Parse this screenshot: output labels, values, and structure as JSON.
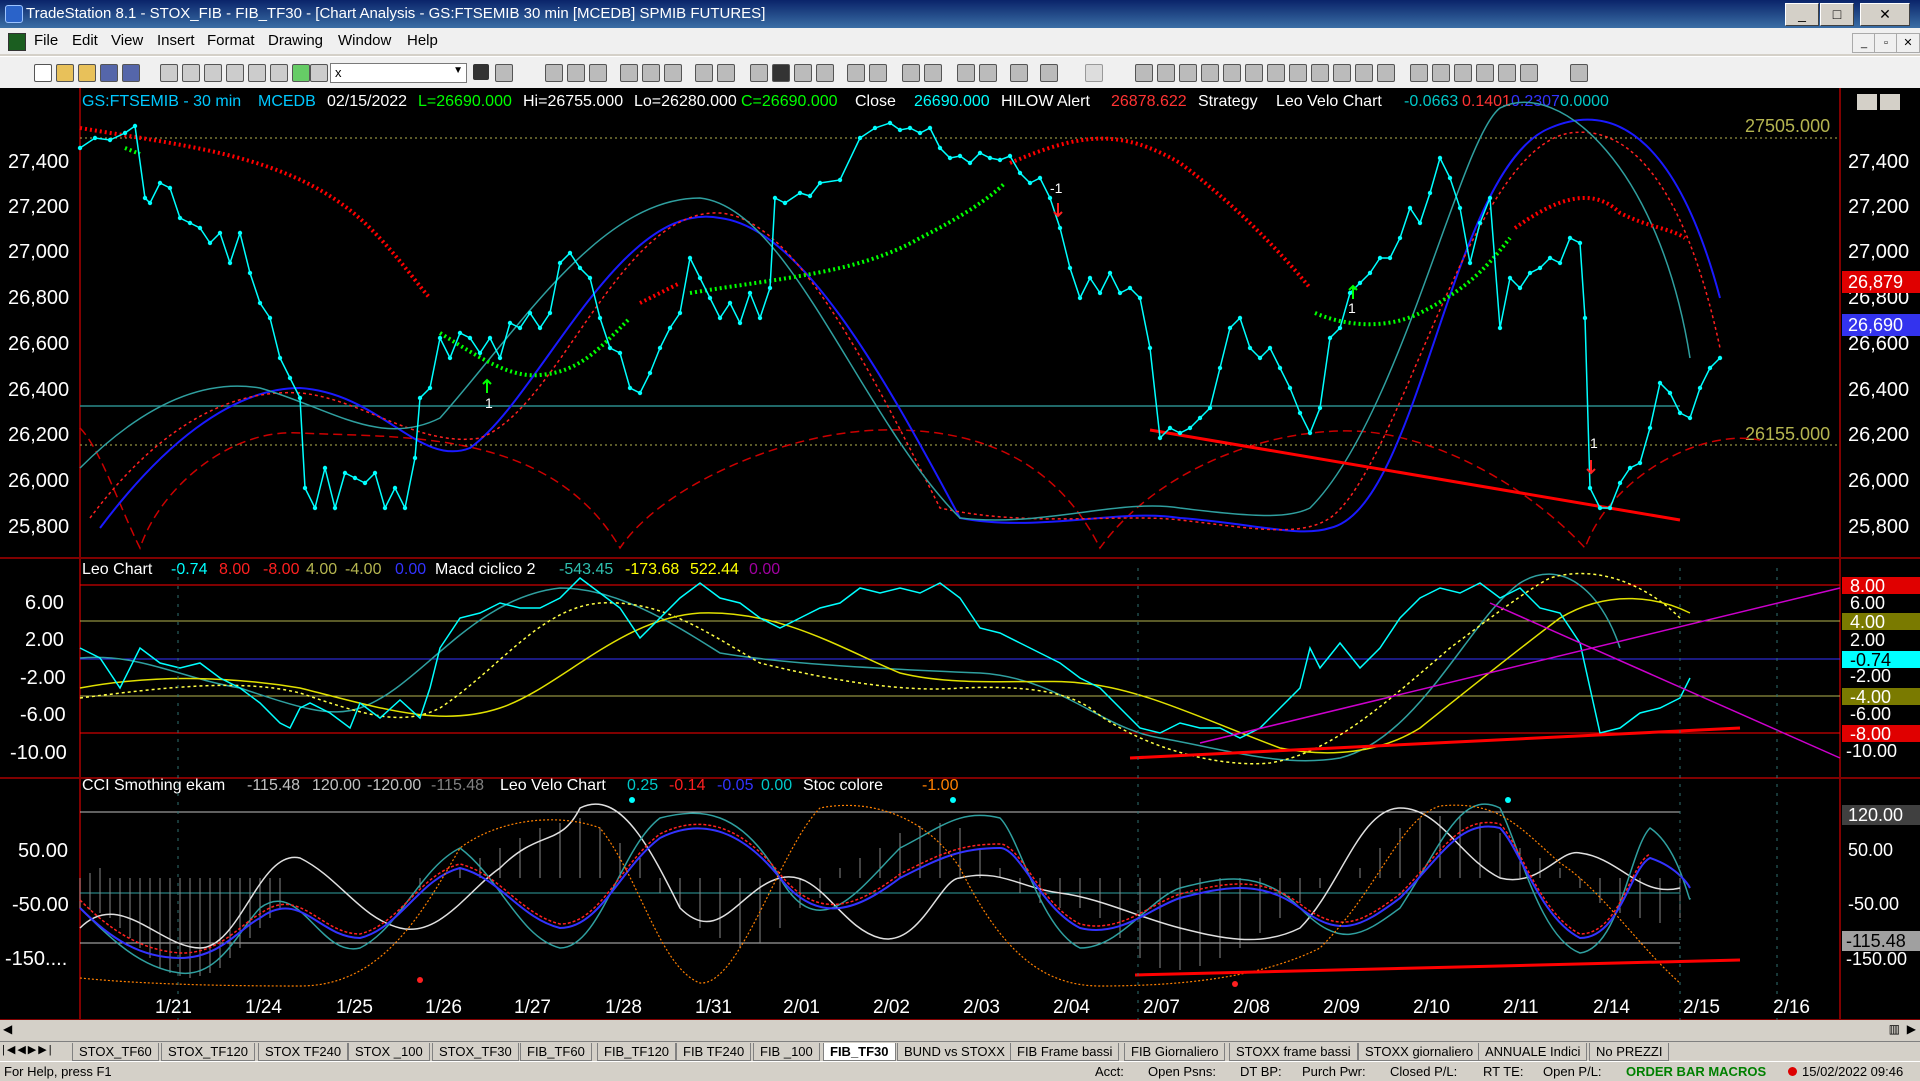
{
  "window": {
    "title": "TradeStation 8.1 - STOX_FIB - FIB_TF30 - [Chart Analysis - GS:FTSEMIB  30 min  [MCEDB] SPMIB FUTURES]",
    "minimize": "_",
    "maximize": "□",
    "close": "✕"
  },
  "menu": [
    "File",
    "Edit",
    "View",
    "Insert",
    "Format",
    "Drawing",
    "Window",
    "Help"
  ],
  "toolbar": {
    "combo_value": "x"
  },
  "chart": {
    "price_header": {
      "symbol": "GS:FTSEMIB - 30 min",
      "feed": "MCEDB",
      "date": "02/15/2022",
      "open": "L=26690.000",
      "high": "Hi=26755.000",
      "low": "Lo=26280.000",
      "close": "C=26690.000",
      "close_label": "Close",
      "close_value": "26690.000",
      "alert_label": "HILOW Alert",
      "alert_value": "26878.622",
      "strategy": "Strategy",
      "velo_label": "Leo Velo Chart",
      "velo_v1": "-0.0663",
      "velo_v2": "0.1401",
      "velo_v3": "0.2307",
      "velo_v4": "0.0000"
    },
    "price_axis": [
      "27,400",
      "27,200",
      "27,000",
      "26,800",
      "26,600",
      "26,400",
      "26,200",
      "26,000",
      "25,800"
    ],
    "price_markers": {
      "upper_level": "27505.000",
      "lower_level": "26155.000",
      "alert_tag": "26,879",
      "last_tag": "26,690"
    },
    "signal_labels": {
      "minus_one": "-1",
      "one": "1"
    },
    "leo_header": {
      "title": "Leo Chart",
      "v1": "-0.74",
      "v2": "8.00",
      "v3": "-8.00",
      "v4": "4.00",
      "v5": "-4.00",
      "v6": "0.00",
      "macd_title": "Macd ciclico 2",
      "m1": "-543.45",
      "m2": "-173.68",
      "m3": "522.44",
      "m4": "0.00"
    },
    "leo_axis": [
      "6.00",
      "2.00",
      "-2.00",
      "-6.00",
      "-10.00"
    ],
    "leo_tags": {
      "t8": "8.00",
      "t6": "6.00",
      "t4": "4.00",
      "t2": "2.00",
      "cur": "-0.74",
      "tm2": "-2.00",
      "tm4": "-4.00",
      "tm6": "-6.00",
      "tm8": "-8.00",
      "tm10": "-10.00"
    },
    "cci_header": {
      "title": "CCI Smothing ekam",
      "v1": "-115.48",
      "v2": "120.00",
      "v3": "-120.00",
      "v4": "-115.48",
      "velo_title": "Leo Velo Chart",
      "w1": "0.25",
      "w2": "-0.14",
      "w3": "-0.05",
      "w4": "0.00",
      "stoc_title": "Stoc colore",
      "s1": "-1.00"
    },
    "cci_axis": [
      "50.00",
      "-50.00",
      "-150...."
    ],
    "cci_tags": {
      "t120": "120.00",
      "t50": "50.00",
      "tm50": "-50.00",
      "cur": "-115.48",
      "tm150": "-150.00"
    },
    "date_axis": [
      "1/21",
      "1/24",
      "1/25",
      "1/26",
      "1/27",
      "1/28",
      "1/31",
      "2/01",
      "2/02",
      "2/03",
      "2/04",
      "2/07",
      "2/08",
      "2/09",
      "2/10",
      "2/11",
      "2/14",
      "2/15",
      "2/16"
    ],
    "colors": {
      "background": "#000000",
      "price": "#00ffff",
      "up_dots": "#00ff00",
      "down_dots": "#ff0000",
      "trend": "#ff0000",
      "level": "#b5b550"
    }
  },
  "tabs": [
    "STOX_TF60",
    "STOX_TF120",
    "STOX TF240",
    "STOX _100",
    "STOX_TF30",
    "FIB_TF60",
    "FIB_TF120",
    "FIB TF240",
    "FIB _100",
    "FIB_TF30",
    "BUND vs STOXX",
    "FIB Frame bassi",
    "FIB Giornaliero",
    "STOXX frame bassi",
    "STOXX giornaliero",
    "ANNUALE Indici",
    "No PREZZI"
  ],
  "active_tab": "FIB_TF30",
  "status": {
    "help": "For Help, press F1",
    "acct": "Acct:",
    "open_psns": "Open Psns:",
    "dt_bp": "DT BP:",
    "purch_pwr": "Purch Pwr:",
    "closed_pl": "Closed P/L:",
    "rt_te": "RT TE:",
    "open_pl": "Open P/L:",
    "macros": "ORDER BAR  MACROS",
    "datetime": "15/02/2022 09:46"
  }
}
